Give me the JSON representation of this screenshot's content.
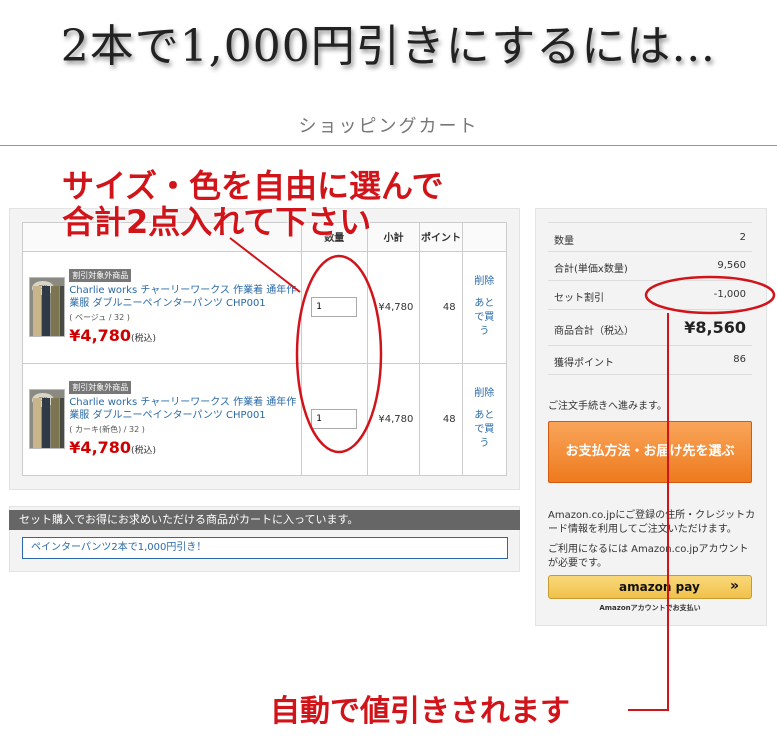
{
  "headline": "2本で1,000円引きにするには…",
  "cart_title": "ショッピングカート",
  "table": {
    "headers": [
      "",
      "数量",
      "小計",
      "ポイント",
      ""
    ],
    "rows": [
      {
        "badge": "割引対象外商品",
        "name": "Charlie works チャーリーワークス 作業着 通年作業服 ダブルニーペインターパンツ CHP001",
        "variant": "( ベージュ / 32 )",
        "price": "¥4,780",
        "tax": "(税込)",
        "qty": "1",
        "subtotal": "¥4,780",
        "points": "48",
        "delete": "削除",
        "later": "あとで買う"
      },
      {
        "badge": "割引対象外商品",
        "name": "Charlie works チャーリーワークス 作業着 通年作業服 ダブルニーペインターパンツ CHP001",
        "variant": "( カーキ(新色) / 32 )",
        "price": "¥4,780",
        "tax": "(税込)",
        "qty": "1",
        "subtotal": "¥4,780",
        "points": "48",
        "delete": "削除",
        "later": "あとで買う"
      }
    ]
  },
  "set_notice": "セット購入でお得にお求めいただける商品がカートに入っています。",
  "set_link": "ペインターパンツ2本で1,000円引き！",
  "summary": {
    "qty_label": "数量",
    "qty_value": "2",
    "subtotal_label": "合計(単価x数量)",
    "subtotal_value": "9,560",
    "set_label": "セット割引",
    "set_value": "-1,000",
    "total_label": "商品合計（税込）",
    "total_value": "¥8,560",
    "points_label": "獲得ポイント",
    "points_value": "86"
  },
  "proceed_text": "ご注文手続きへ進みます。",
  "pay_button": "お支払方法・お届け先を選ぶ",
  "amazon": {
    "text1": "Amazon.co.jpにご登録の住所・クレジットカード情報を利用してご注文いただけます。",
    "text2": "ご利用になるには Amazon.co.jpアカウントが必要です。",
    "button_logo": "amazon pay",
    "button_arrow": "»",
    "caption": "Amazonアカウントでお支払い"
  },
  "annotations": {
    "top_line1": "サイズ・色を自由に選んで",
    "top_line2": "合計2点入れて下さい",
    "bottom": "自動で値引きされます"
  },
  "colors": {
    "annotation": "#d0141a",
    "link": "#2a6aa8",
    "price": "#d10000",
    "pay_button": "#ee7a1e"
  }
}
